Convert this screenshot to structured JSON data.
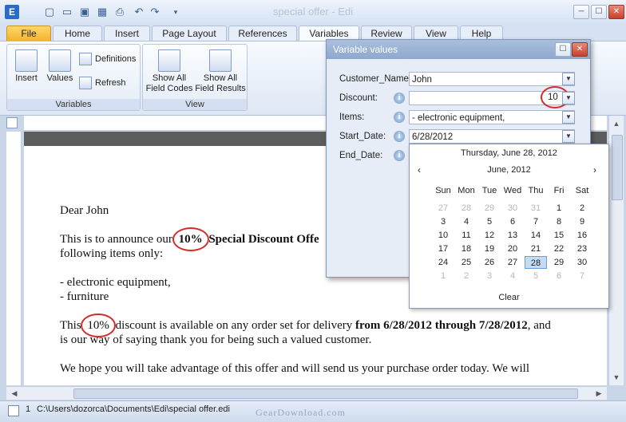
{
  "window": {
    "title": "special offer - Edi",
    "app_icon": "E",
    "controls": {
      "minimize": "─",
      "maximize": "☐",
      "close": "✕"
    }
  },
  "quick_access": [
    "new-doc-icon",
    "open-folder-icon",
    "save-icon",
    "save-all-icon",
    "print-icon",
    "undo-icon",
    "redo-icon",
    "customize-dropdown-icon"
  ],
  "tabs": [
    "File",
    "Home",
    "Insert",
    "Page Layout",
    "References",
    "Variables",
    "Review",
    "View",
    "Help"
  ],
  "active_tab": "Variables",
  "ribbon": {
    "variables_group": {
      "label": "Variables",
      "insert": "Insert",
      "values": "Values",
      "definitions": "Definitions",
      "refresh": "Refresh"
    },
    "view_group": {
      "label": "View",
      "show_codes": [
        "Show All",
        "Field Codes"
      ],
      "show_results": [
        "Show All",
        "Field Results"
      ]
    }
  },
  "document": {
    "greeting": "Dear John",
    "p1_a": "This is to announce our ",
    "p1_b": "10%",
    "p1_c": " Special Discount Offe",
    "p1_d": "following items only:",
    "items": [
      "- electronic equipment,",
      "- furniture"
    ],
    "p2_a": "This ",
    "p2_b": "10%",
    "p2_c": " discount is available on any order set for delivery ",
    "p2_d": "from 6/28/2012 through 7/28/2012",
    "p2_e": ", and",
    "p2_f": "is our way of saying thank you for being such a valued customer.",
    "p3": "We hope you will take advantage of this offer and will send us your purchase order today.  We will"
  },
  "status": {
    "page": "1",
    "path": "C:\\Users\\dozorca\\Documents\\Edi\\special offer.edi"
  },
  "watermark": "GearDownload.com",
  "dialog": {
    "title": "Variable values",
    "fields": [
      {
        "label": "Customer_Name:",
        "value": "John",
        "info": false
      },
      {
        "label": "Discount:",
        "value": "10",
        "info": true
      },
      {
        "label": "Items:",
        "value": "- electronic equipment,",
        "info": true
      },
      {
        "label": "Start_Date:",
        "value": "6/28/2012",
        "info": true
      },
      {
        "label": "End_Date:",
        "value": "",
        "info": true
      }
    ]
  },
  "calendar": {
    "today_label": "Thursday, June 28, 2012",
    "month_label": "June, 2012",
    "weekdays": [
      "Sun",
      "Mon",
      "Tue",
      "Wed",
      "Thu",
      "Fri",
      "Sat"
    ],
    "weeks": [
      [
        "27",
        "28",
        "29",
        "30",
        "31",
        "1",
        "2"
      ],
      [
        "3",
        "4",
        "5",
        "6",
        "7",
        "8",
        "9"
      ],
      [
        "10",
        "11",
        "12",
        "13",
        "14",
        "15",
        "16"
      ],
      [
        "17",
        "18",
        "19",
        "20",
        "21",
        "22",
        "23"
      ],
      [
        "24",
        "25",
        "26",
        "27",
        "28",
        "29",
        "30"
      ],
      [
        "1",
        "2",
        "3",
        "4",
        "5",
        "6",
        "7"
      ]
    ],
    "selected": "28",
    "clear": "Clear"
  }
}
